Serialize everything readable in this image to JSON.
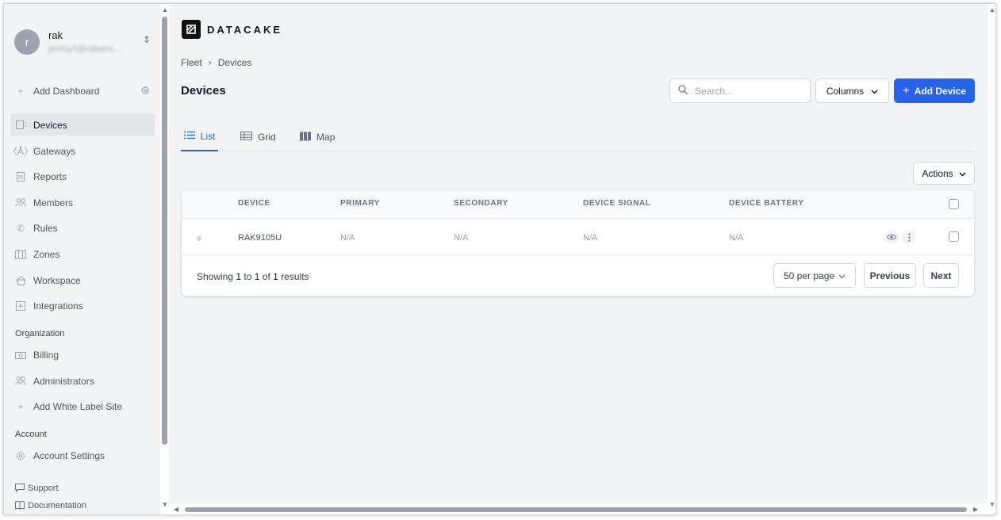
{
  "user": {
    "initial": "r",
    "name": "rak",
    "email": "jimmy.li@rakwire..."
  },
  "sidebar": {
    "add_dashboard": "Add Dashboard",
    "items": [
      {
        "label": "Devices",
        "icon": "devices-icon",
        "active": true
      },
      {
        "label": "Gateways",
        "icon": "gateway-icon"
      },
      {
        "label": "Reports",
        "icon": "report-icon"
      },
      {
        "label": "Members",
        "icon": "members-icon"
      },
      {
        "label": "Rules",
        "icon": "rules-icon"
      },
      {
        "label": "Zones",
        "icon": "map-icon"
      },
      {
        "label": "Workspace",
        "icon": "home-icon"
      },
      {
        "label": "Integrations",
        "icon": "integrations-icon"
      }
    ],
    "organization_label": "Organization",
    "org_items": [
      {
        "label": "Billing",
        "icon": "billing-icon"
      },
      {
        "label": "Administrators",
        "icon": "admins-icon"
      },
      {
        "label": "Add White Label Site",
        "icon": "plus-icon"
      }
    ],
    "account_label": "Account",
    "account_items": [
      {
        "label": "Account Settings",
        "icon": "gear-icon"
      }
    ],
    "support": "Support",
    "documentation": "Documentation"
  },
  "brand": {
    "name": "DATACAKE"
  },
  "breadcrumb": {
    "root": "Fleet",
    "current": "Devices"
  },
  "page": {
    "title": "Devices"
  },
  "search": {
    "placeholder": "Search..."
  },
  "toolbar": {
    "columns_label": "Columns",
    "add_device_label": "Add Device",
    "actions_label": "Actions"
  },
  "tabs": [
    {
      "label": "List",
      "active": true
    },
    {
      "label": "Grid"
    },
    {
      "label": "Map"
    }
  ],
  "table": {
    "columns": [
      "DEVICE",
      "PRIMARY",
      "SECONDARY",
      "DEVICE SIGNAL",
      "DEVICE BATTERY"
    ],
    "rows": [
      {
        "device": "RAK9105U",
        "primary": "N/A",
        "secondary": "N/A",
        "signal": "N/A",
        "battery": "N/A"
      }
    ]
  },
  "pagination": {
    "showing": "Showing",
    "from": "1",
    "to_word": "to",
    "to": "1",
    "of_word": "of",
    "total": "1",
    "results_word": "results",
    "per_page": "50 per page",
    "previous": "Previous",
    "next": "Next"
  },
  "colors": {
    "accent": "#2563eb",
    "sidebar_bg": "#f3f4f6",
    "active_item_bg": "#e5e7eb"
  }
}
